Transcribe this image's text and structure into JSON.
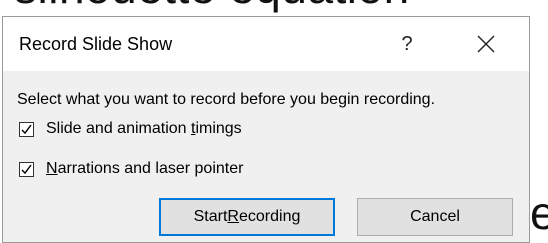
{
  "background": {
    "top_text": "silhouette equation",
    "right_text": "e"
  },
  "dialog": {
    "title": "Record Slide Show",
    "help_label": "?",
    "prompt": "Select what you want to record before you begin recording.",
    "options": [
      {
        "label_pre": "Slide and animation ",
        "label_key": "t",
        "label_post": "imings",
        "checked": true
      },
      {
        "label_pre": "",
        "label_key": "N",
        "label_post": "arrations and laser pointer",
        "checked": true
      }
    ],
    "buttons": {
      "start_pre": "Start ",
      "start_key": "R",
      "start_post": "ecording",
      "cancel": "Cancel"
    }
  },
  "colors": {
    "dialog_bg": "#f0f0f0",
    "titlebar_bg": "#ffffff",
    "focus_border": "#0078d7",
    "button_bg": "#e1e1e1"
  }
}
